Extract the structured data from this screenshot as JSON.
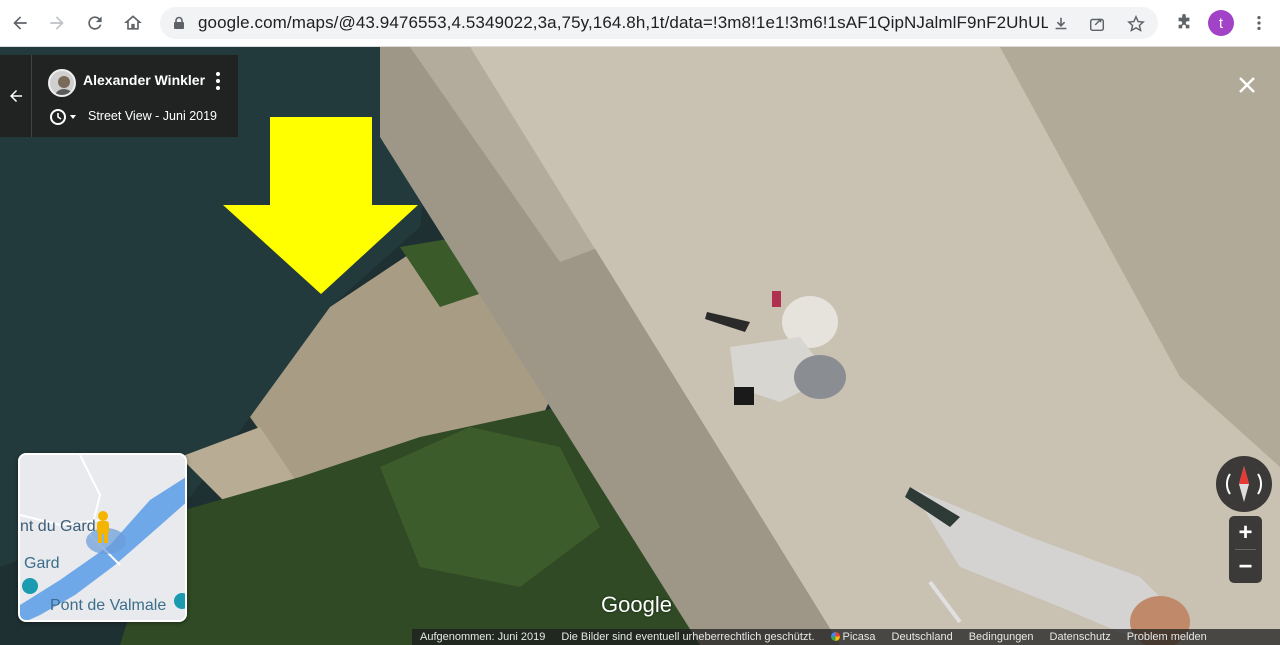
{
  "browser": {
    "url": "google.com/maps/@43.9476553,4.5349022,3a,75y,164.8h,1t/data=!3m8!1e1!3m6!1sAF1QipNJalmlF9nF2UhULfR3...",
    "profile_initial": "t",
    "icons": [
      "back-arrow-icon",
      "forward-arrow-icon",
      "reload-icon",
      "home-icon",
      "lock-icon",
      "download-icon",
      "share-icon",
      "star-icon",
      "puzzle-icon",
      "more-vert-icon"
    ]
  },
  "streetview": {
    "author": "Alexander Winkler",
    "date_label": "Street View - Juni 2019",
    "google_logo": "Google"
  },
  "minimap": {
    "labels": [
      "nt du Gard",
      "Gard",
      "Pont de Valmale"
    ]
  },
  "controls": {
    "zoom_in": "+",
    "zoom_out": "−"
  },
  "footer": {
    "captured": "Aufgenommen: Juni 2019",
    "copyright": "Die Bilder sind eventuell urheberrechtlich geschützt.",
    "picasa": "Picasa",
    "country": "Deutschland",
    "terms": "Bedingungen",
    "privacy": "Datenschutz",
    "report": "Problem melden"
  },
  "colors": {
    "overlay_arrow": "#ffff00",
    "profile": "#a142c7",
    "water": "#6fa8e8"
  }
}
